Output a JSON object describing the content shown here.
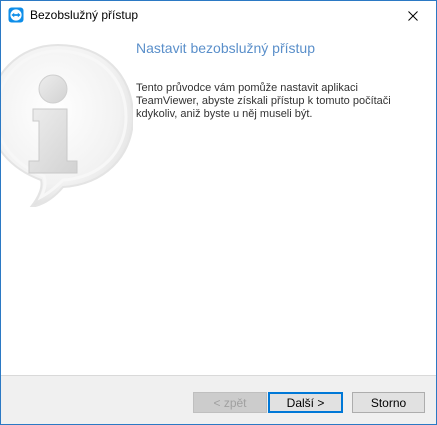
{
  "window": {
    "title": "Bezobslužný přístup",
    "app_icon": "teamviewer-icon",
    "close_icon": "close-icon"
  },
  "content": {
    "graphic_icon": "info-icon",
    "heading": "Nastavit bezobslužný přístup",
    "description": "Tento průvodce vám pomůže nastavit aplikaci TeamViewer, abyste získali přístup k tomuto počítači kdykoliv, aniž byste u něj museli být."
  },
  "buttons": {
    "back": "< zpět",
    "next": "Další >",
    "cancel": "Storno"
  },
  "colors": {
    "heading": "#5a8fca",
    "accent": "#0078d7",
    "teamviewer_blue": "#0e8ee9"
  }
}
